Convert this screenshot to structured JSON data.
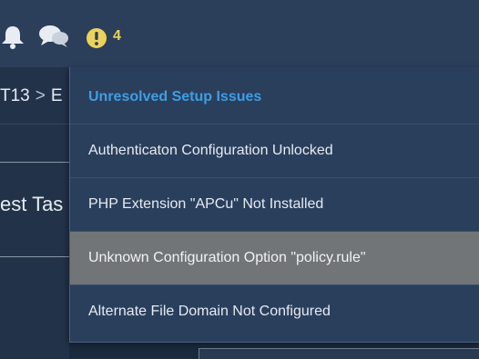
{
  "topbar": {
    "icons": [
      "bell-icon",
      "chat-icon",
      "warning-icon"
    ],
    "warning_count": "4",
    "warning_color": "#ecd25a"
  },
  "breadcrumb": {
    "item_1": "T13",
    "separator": ">",
    "item_2": "E"
  },
  "main": {
    "task_title_fragment": "est Tas"
  },
  "dropdown": {
    "header": "Unresolved Setup Issues",
    "header_color": "#3f9de3",
    "items": [
      {
        "label": "Authenticaton Configuration Unlocked"
      },
      {
        "label": "PHP Extension \"APCu\" Not Installed"
      },
      {
        "label": "Unknown Configuration Option \"policy.rule\""
      },
      {
        "label": "Alternate File Domain Not Configured"
      }
    ],
    "highlighted_index": 2
  }
}
